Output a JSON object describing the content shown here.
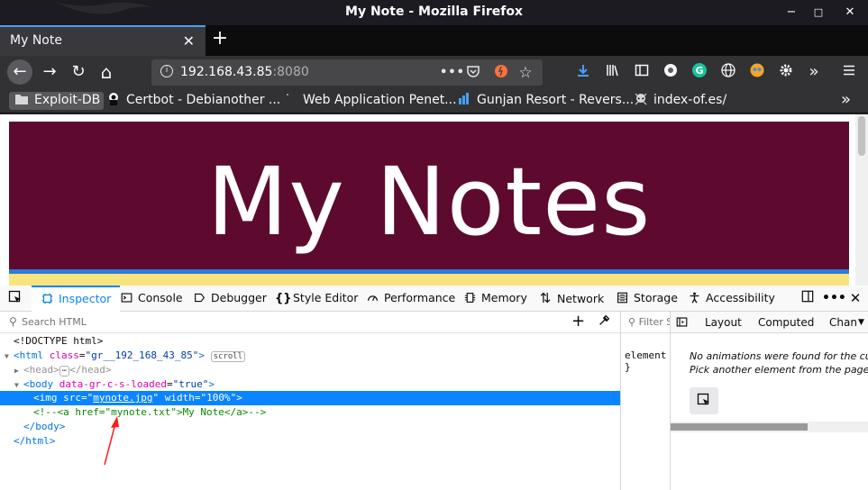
{
  "window": {
    "title": "My Note - Mozilla Firefox",
    "controls": {
      "minimize": "−",
      "maximize": "□",
      "close": "✕"
    }
  },
  "tabs": [
    {
      "label": "My Note",
      "close": "✕"
    }
  ],
  "new_tab": "+",
  "nav": {
    "back": "←",
    "forward": "→",
    "reload": "↻",
    "home": "⌂",
    "url_host": "192.168.43.85",
    "url_port": ":8080",
    "url_icons": [
      "page-actions-icon",
      "pocket-icon",
      "reader-icon",
      "bookmark-star-icon"
    ],
    "toolbar_icons": [
      "download-icon",
      "library-icon",
      "sidebar-icon",
      "account-icon",
      "grammarly-icon",
      "globe-icon",
      "extension-face-icon",
      "gear-icon",
      "overflow-icon",
      "menu-icon"
    ]
  },
  "bookmarks": [
    {
      "label": "Exploit-DB",
      "icon": "folder-icon"
    },
    {
      "label": "Certbot - Debianother ...",
      "icon": "certbot-icon"
    },
    {
      "label": "Web Application Penet...",
      "icon": "dot-icon"
    },
    {
      "label": "Gunjan Resort - Revers...",
      "icon": "chart-icon"
    },
    {
      "label": "index-of.es/",
      "icon": "skull-icon"
    }
  ],
  "bookmarks_overflow": "»",
  "page": {
    "banner_text": "My Notes",
    "colors": {
      "banner": "#5e0a2e",
      "stripe_blue": "#2e7bd8",
      "stripe_yellow": "#f8e47e"
    }
  },
  "devtools": {
    "tabs": [
      {
        "label": "Inspector",
        "icon": "inspector-icon",
        "active": true
      },
      {
        "label": "Console",
        "icon": "console-icon"
      },
      {
        "label": "Debugger",
        "icon": "debugger-icon"
      },
      {
        "label": "Style Editor",
        "icon": "style-editor-icon"
      },
      {
        "label": "Performance",
        "icon": "performance-icon"
      },
      {
        "label": "Memory",
        "icon": "memory-icon"
      },
      {
        "label": "Network",
        "icon": "network-icon"
      },
      {
        "label": "Storage",
        "icon": "storage-icon"
      },
      {
        "label": "Accessibility",
        "icon": "accessibility-icon"
      }
    ],
    "search_placeholder": "Search HTML",
    "filter_placeholder": "Filter Styles",
    "markup": {
      "doctype": "<!DOCTYPE html>",
      "html_open_tag": "<html ",
      "html_attr": "class",
      "html_val": "\"gr__192_168_43_85\"",
      "html_close": ">",
      "scroll_badge": "scroll",
      "head_open": "<head>",
      "head_ellipsis": "⋯",
      "head_close": "</head>",
      "body_open_tag": "<body ",
      "body_attr": "data-gr-c-s-loaded",
      "body_val": "\"true\"",
      "body_close_gt": ">",
      "img_open": "<img ",
      "img_src_attr": "src",
      "img_src_val": "mynote.jpg",
      "img_width_attr": "width",
      "img_width_val": "\"100%\"",
      "img_close": ">",
      "comment": "<!--<a href=\"mynote.txt\">My Note</a>-->",
      "body_end": "</body>",
      "html_end": "</html>"
    },
    "rules_text": "element {\n}",
    "side_tabs": [
      "Layout",
      "Computed",
      "Chan"
    ],
    "animations_message_1": "No animations were found for the cu",
    "animations_message_2": "Pick another element from the page."
  }
}
